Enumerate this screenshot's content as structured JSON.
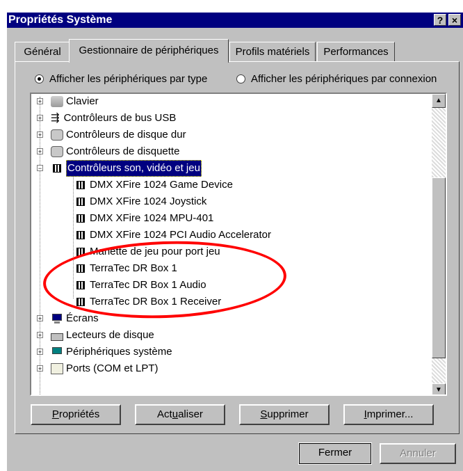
{
  "window": {
    "title": "Propriétés Système",
    "help_label": "?",
    "close_label": "×"
  },
  "tabs": [
    {
      "label": "Général"
    },
    {
      "label": "Gestionnaire de périphériques"
    },
    {
      "label": "Profils matériels"
    },
    {
      "label": "Performances"
    }
  ],
  "view_options": {
    "by_type": "Afficher les périphériques par type",
    "by_connection": "Afficher les périphériques par connexion",
    "selected": "by_type"
  },
  "tree": {
    "categories_top": [
      {
        "label": "Clavier",
        "expander": "+",
        "icon": "keyboard-icon"
      },
      {
        "label": "Contrôleurs de bus USB",
        "expander": "+",
        "icon": "usb-icon"
      },
      {
        "label": "Contrôleurs de disque dur",
        "expander": "+",
        "icon": "disk-controller-icon"
      },
      {
        "label": "Contrôleurs de disquette",
        "expander": "+",
        "icon": "floppy-controller-icon"
      }
    ],
    "expanded_category": {
      "label": "Contrôleurs son, vidéo et jeu",
      "expander": "−",
      "icon": "sound-video-game-icon"
    },
    "devices": [
      "DMX XFire 1024 Game Device",
      "DMX XFire 1024 Joystick",
      "DMX XFire 1024 MPU-401",
      "DMX XFire 1024 PCI Audio Accelerator",
      "Manette de jeu pour port jeu",
      "TerraTec DR Box 1",
      "TerraTec DR Box 1 Audio",
      "TerraTec DR Box 1 Receiver"
    ],
    "categories_bottom": [
      {
        "label": "Écrans",
        "expander": "+",
        "icon": "monitor-icon"
      },
      {
        "label": "Lecteurs de disque",
        "expander": "+",
        "icon": "disk-drive-icon"
      },
      {
        "label": "Périphériques système",
        "expander": "+",
        "icon": "system-device-icon"
      },
      {
        "label": "Ports (COM et LPT)",
        "expander": "+",
        "icon": "port-icon"
      }
    ]
  },
  "scrollbar": {
    "up": "▲",
    "down": "▼"
  },
  "action_buttons": {
    "properties": {
      "pre": "",
      "u": "P",
      "post": "ropriétés"
    },
    "refresh": {
      "pre": "Act",
      "u": "u",
      "post": "aliser"
    },
    "remove": {
      "pre": "",
      "u": "S",
      "post": "upprimer"
    },
    "print": {
      "pre": "",
      "u": "I",
      "post": "mprimer..."
    }
  },
  "dialog_buttons": {
    "close": "Fermer",
    "cancel": "Annuler"
  },
  "annotation": {
    "color": "#ff0000",
    "shape": "ellipse"
  },
  "colors": {
    "face": "#c0c0c0",
    "title": "#000080",
    "selection": "#000080"
  }
}
